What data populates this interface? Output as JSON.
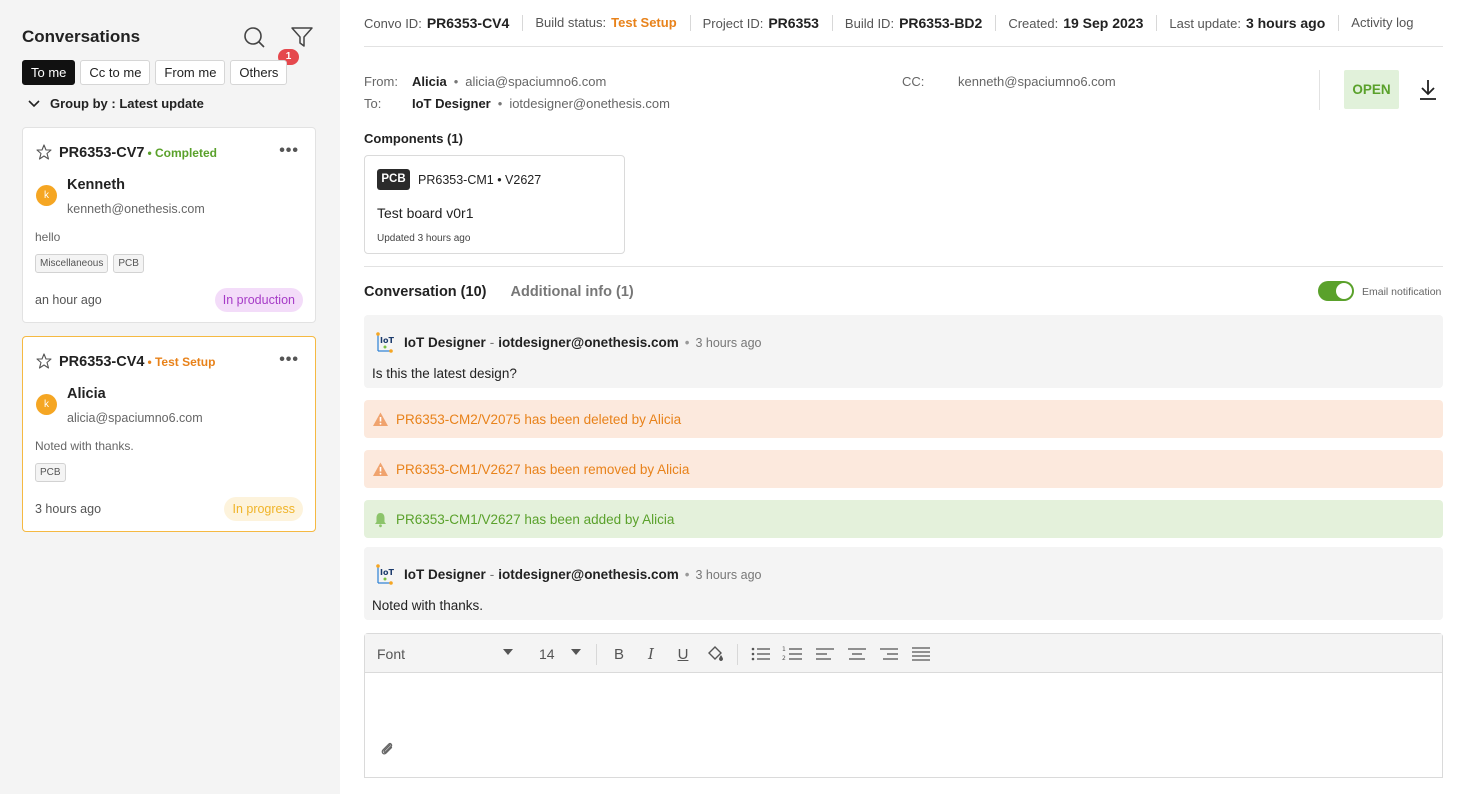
{
  "sidebar": {
    "title": "Conversations",
    "filter_badge": "1",
    "tabs": [
      "To me",
      "Cc to me",
      "From me",
      "Others"
    ],
    "group_by": "Group by : Latest update",
    "cards": [
      {
        "id": "PR6353-CV7",
        "status": "• Completed",
        "status_color": "#5aa12b",
        "avatar": "k",
        "name": "Kenneth",
        "email": "kenneth@onethesis.com",
        "message": "hello",
        "tags": [
          "Miscellaneous",
          "PCB"
        ],
        "time": "an hour ago",
        "pill": "In production",
        "pill_bg": "#f3dcf9",
        "pill_color": "#a63bc7"
      },
      {
        "id": "PR6353-CV4",
        "status": "• Test Setup",
        "status_color": "#e8821a",
        "avatar": "k",
        "name": "Alicia",
        "email": "alicia@spaciumno6.com",
        "message": "Noted with thanks.",
        "tags": [
          "PCB"
        ],
        "time": "3 hours ago",
        "pill": "In progress",
        "pill_bg": "#fdf3dc",
        "pill_color": "#f0b429"
      }
    ]
  },
  "header": {
    "convo_label": "Convo ID:",
    "convo_id": "PR6353-CV4",
    "build_status_label": "Build status:",
    "build_status": "Test Setup",
    "project_label": "Project ID:",
    "project_id": "PR6353",
    "build_label": "Build ID:",
    "build_id": "PR6353-BD2",
    "created_label": "Created:",
    "created": "19 Sep 2023",
    "update_label": "Last update:",
    "last_update": "3 hours ago",
    "activity_log": "Activity log"
  },
  "participants": {
    "from_label": "From:",
    "from_name": "Alicia",
    "from_email": "alicia@spaciumno6.com",
    "to_label": "To:",
    "to_name": "IoT Designer",
    "to_email": "iotdesigner@onethesis.com",
    "cc_label": "CC:",
    "cc_email": "kenneth@spaciumno6.com",
    "open_label": "OPEN"
  },
  "components": {
    "title": "Components (1)",
    "items": [
      {
        "badge": "PCB",
        "id": "PR6353-CM1 • V2627",
        "name": "Test board v0r1",
        "updated": "Updated 3 hours ago"
      }
    ]
  },
  "conversation": {
    "tab_conversation": "Conversation (10)",
    "tab_additional": "Additional info (1)",
    "email_notification": "Email notification",
    "email_notification_on": true,
    "messages": [
      {
        "author": "IoT Designer",
        "email": "iotdesigner@onethesis.com",
        "time": "3 hours ago",
        "text": "Is this the latest design?"
      },
      {
        "author": "IoT Designer",
        "email": "iotdesigner@onethesis.com",
        "time": "3 hours ago",
        "text": "Noted with thanks."
      }
    ],
    "events": [
      {
        "type": "warning",
        "text": "PR6353-CM2/V2075 has been deleted by Alicia"
      },
      {
        "type": "warning",
        "text": "PR6353-CM1/V2627 has been removed by Alicia"
      },
      {
        "type": "success",
        "text": "PR6353-CM1/V2627 has been added by Alicia"
      }
    ]
  },
  "editor": {
    "font": "Font",
    "size": "14",
    "tools": [
      "bold-icon",
      "italic-icon",
      "underline-icon",
      "paint-bucket-icon",
      "bullet-list-icon",
      "numbered-list-icon",
      "align-left-icon",
      "align-center-icon",
      "align-right-icon",
      "align-justify-icon",
      "paperclip-icon"
    ]
  },
  "colors": {
    "accent_green": "#5aa12b",
    "accent_orange": "#e8821a",
    "selected_border": "#f5b942",
    "badge_red": "#e5484d"
  }
}
